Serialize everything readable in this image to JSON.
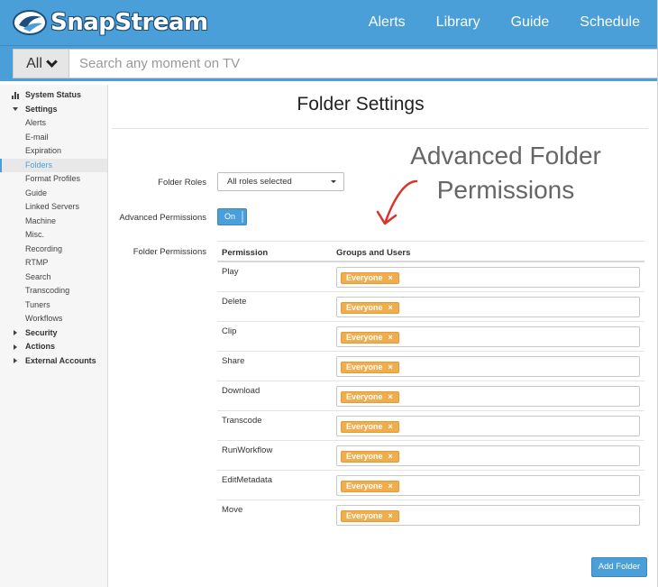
{
  "header": {
    "brand": "SnapStream",
    "nav": [
      {
        "label": "Alerts"
      },
      {
        "label": "Library"
      },
      {
        "label": "Guide"
      },
      {
        "label": "Schedule"
      }
    ],
    "colors": {
      "bar": "#4a9fd8",
      "accent": "#f0ad4e"
    }
  },
  "search": {
    "scope": "All",
    "placeholder": "Search any moment on TV",
    "value": ""
  },
  "sidebar": {
    "items": [
      {
        "label": "System Status",
        "level": "top",
        "icon": "bar-chart-icon"
      },
      {
        "label": "Settings",
        "level": "top",
        "icon": "caret-down-icon"
      },
      {
        "label": "Alerts",
        "level": "sub"
      },
      {
        "label": "E-mail",
        "level": "sub"
      },
      {
        "label": "Expiration",
        "level": "sub"
      },
      {
        "label": "Folders",
        "level": "sub",
        "active": true
      },
      {
        "label": "Format Profiles",
        "level": "sub"
      },
      {
        "label": "Guide",
        "level": "sub"
      },
      {
        "label": "Linked Servers",
        "level": "sub"
      },
      {
        "label": "Machine",
        "level": "sub"
      },
      {
        "label": "Misc.",
        "level": "sub"
      },
      {
        "label": "Recording",
        "level": "sub"
      },
      {
        "label": "RTMP",
        "level": "sub"
      },
      {
        "label": "Search",
        "level": "sub"
      },
      {
        "label": "Transcoding",
        "level": "sub"
      },
      {
        "label": "Tuners",
        "level": "sub"
      },
      {
        "label": "Workflows",
        "level": "sub"
      },
      {
        "label": "Security",
        "level": "top",
        "icon": "caret-right-icon"
      },
      {
        "label": "Actions",
        "level": "top",
        "icon": "caret-right-icon"
      },
      {
        "label": "External Accounts",
        "level": "top",
        "icon": "caret-right-icon"
      }
    ]
  },
  "main": {
    "title": "Folder Settings",
    "annotation_line1": "Advanced Folder",
    "annotation_line2": "Permissions",
    "folder_roles_label": "Folder Roles",
    "folder_roles_value": "All roles selected",
    "advanced_permissions_label": "Advanced Permissions",
    "advanced_permissions_toggle": "On",
    "folder_permissions_label": "Folder Permissions",
    "table": {
      "col_permission": "Permission",
      "col_groups": "Groups and Users",
      "rows": [
        {
          "permission": "Play",
          "tag": "Everyone"
        },
        {
          "permission": "Delete",
          "tag": "Everyone"
        },
        {
          "permission": "Clip",
          "tag": "Everyone"
        },
        {
          "permission": "Share",
          "tag": "Everyone"
        },
        {
          "permission": "Download",
          "tag": "Everyone"
        },
        {
          "permission": "Transcode",
          "tag": "Everyone"
        },
        {
          "permission": "RunWorkflow",
          "tag": "Everyone"
        },
        {
          "permission": "EditMetadata",
          "tag": "Everyone"
        },
        {
          "permission": "Move",
          "tag": "Everyone"
        }
      ],
      "remove_glyph": "×"
    },
    "add_folder_label": "Add Folder"
  }
}
